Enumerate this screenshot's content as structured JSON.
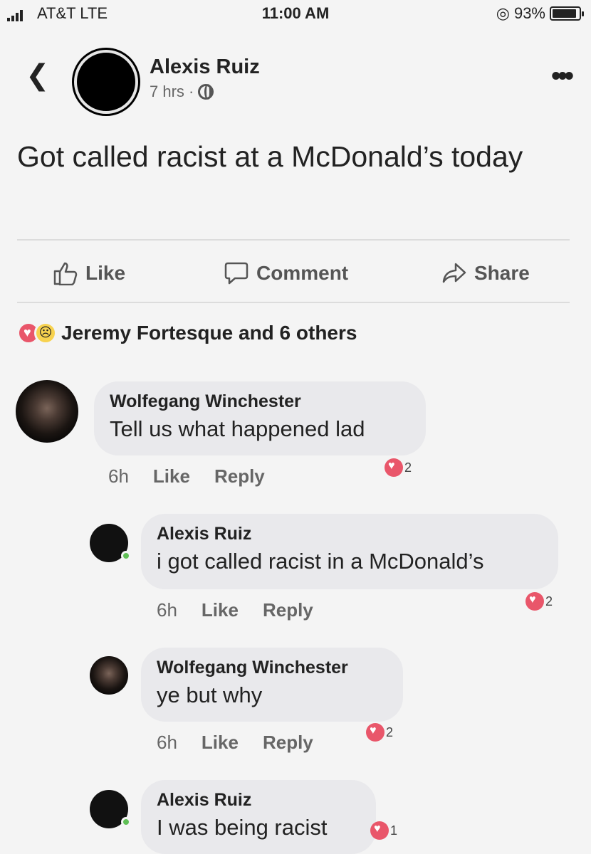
{
  "status_bar": {
    "carrier": "AT&T  LTE",
    "time": "11:00 AM",
    "battery": "93%",
    "battery_level": 0.93
  },
  "post": {
    "author": "Alexis Ruiz",
    "time": "7 hrs ·",
    "text": "Got called racist at a McDonald’s today",
    "actions": {
      "like": "Like",
      "comment": "Comment",
      "share": "Share"
    },
    "reactions_summary": "Jeremy Fortesque and 6 others"
  },
  "comments": [
    {
      "name": "Wolfegang Winchester",
      "text": "Tell us what happened lad",
      "time": "6h",
      "like": "Like",
      "reply": "Reply",
      "reactions": "2"
    },
    {
      "name": "Alexis Ruiz",
      "text": "i got called racist in a McDonald’s",
      "time": "6h",
      "like": "Like",
      "reply": "Reply",
      "reactions": "2"
    },
    {
      "name": "Wolfegang Winchester",
      "text": "ye but why",
      "time": "6h",
      "like": "Like",
      "reply": "Reply",
      "reactions": "2"
    },
    {
      "name": "Alexis Ruiz",
      "text": "I was being racist",
      "reactions": "1"
    }
  ],
  "icons": [
    "signal-icon",
    "location-icon",
    "battery-icon",
    "back-chevron-icon",
    "globe-icon",
    "more-icon",
    "like-icon",
    "comment-icon",
    "share-icon",
    "heart-reaction-icon",
    "sad-reaction-icon"
  ]
}
